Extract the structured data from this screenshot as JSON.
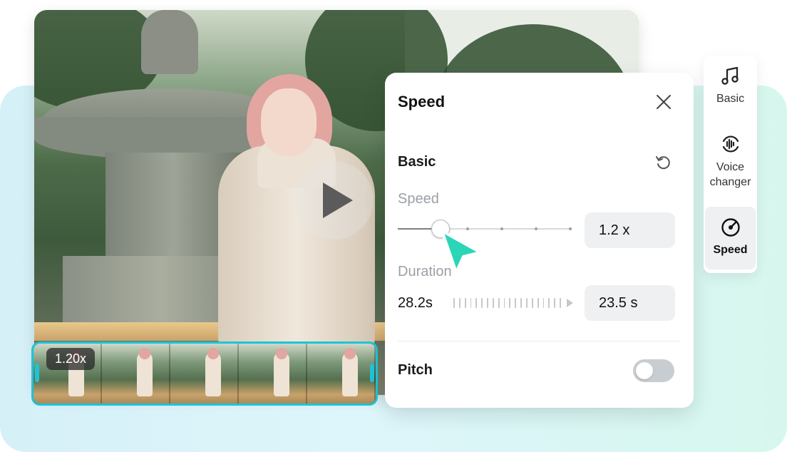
{
  "preview": {
    "timeline_speed_badge": "1.20x"
  },
  "speed_panel": {
    "title": "Speed",
    "section_title": "Basic",
    "speed_label": "Speed",
    "speed_value": "1.2 x",
    "speed_slider_fraction": 0.24,
    "duration_label": "Duration",
    "duration_original": "28.2s",
    "duration_value": "23.5 s",
    "pitch_label": "Pitch",
    "pitch_enabled": false
  },
  "side_rail": {
    "items": [
      {
        "label": "Basic",
        "icon": "music-note-icon"
      },
      {
        "label": "Voice changer",
        "icon": "voice-changer-icon"
      },
      {
        "label": "Speed",
        "icon": "speed-gauge-icon",
        "active": true
      }
    ]
  },
  "colors": {
    "accent": "#1fc3d8",
    "cursor": "#2ad6b7",
    "panel_bg": "#ffffff",
    "value_box_bg": "#eef0f2"
  }
}
